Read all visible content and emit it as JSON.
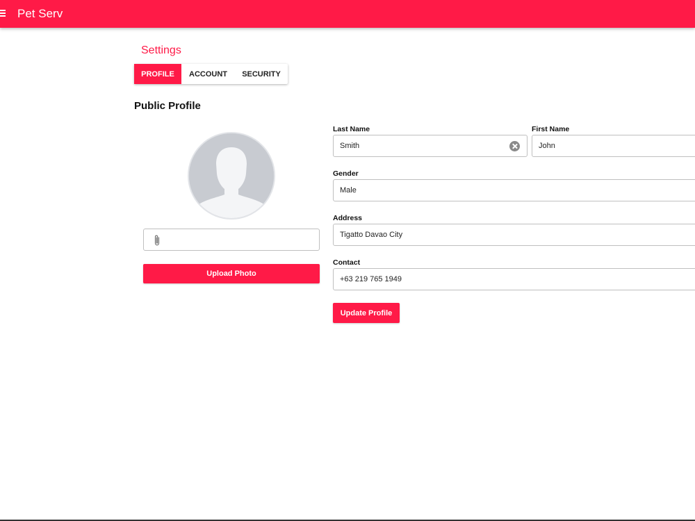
{
  "app": {
    "title": "Pet Serv"
  },
  "colors": {
    "accent": "#ff1a47"
  },
  "page": {
    "title": "Settings"
  },
  "tabs": [
    {
      "label": "PROFILE",
      "active": true
    },
    {
      "label": "ACCOUNT",
      "active": false
    },
    {
      "label": "SECURITY",
      "active": false
    }
  ],
  "profile": {
    "section_title": "Public Profile",
    "avatar_icon": "user-silhouette-icon",
    "file_input_icon": "paperclip-icon",
    "upload_button": "Upload Photo",
    "fields": {
      "last_name": {
        "label": "Last Name",
        "value": "Smith"
      },
      "first_name": {
        "label": "First Name",
        "value": "John"
      },
      "gender": {
        "label": "Gender",
        "value": "Male"
      },
      "address": {
        "label": "Address",
        "value": "Tigatto Davao City"
      },
      "contact": {
        "label": "Contact",
        "value": "+63 219 765 1949"
      }
    },
    "update_button": "Update Profile"
  }
}
